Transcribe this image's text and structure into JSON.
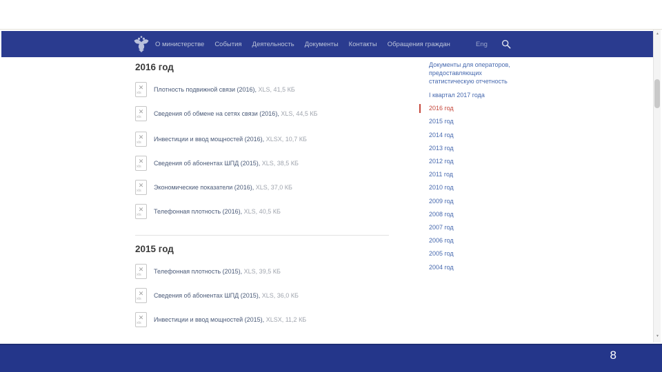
{
  "navbar": {
    "logo_icon": "russian-coat-of-arms",
    "items": [
      "О министерстве",
      "События",
      "Деятельность",
      "Документы",
      "Контакты",
      "Обращения граждан"
    ],
    "lang_label": "Eng",
    "search_icon": "magnifier"
  },
  "content": {
    "file_icon_label": "xls",
    "sections": [
      {
        "heading": "2016 год",
        "items": [
          {
            "title": "Плотность подвижной связи (2016),",
            "meta": "XLS, 41,5 КБ"
          },
          {
            "title": "Сведения об обмене на сетях связи (2016),",
            "meta": "XLS, 44,5 КБ"
          },
          {
            "title": "Инвестиции и ввод мощностей (2016),",
            "meta": "XLSX, 10,7 КБ"
          },
          {
            "title": "Сведения об абонентах ШПД (2015),",
            "meta": "XLS, 38,5 КБ"
          },
          {
            "title": "Экономические показатели (2016),",
            "meta": "XLS, 37,0 КБ"
          },
          {
            "title": "Телефонная плотность (2016),",
            "meta": "XLS, 40,5 КБ"
          }
        ]
      },
      {
        "heading": "2015 год",
        "items": [
          {
            "title": "Телефонная плотность (2015),",
            "meta": "XLS, 39,5 КБ"
          },
          {
            "title": "Сведения об абонентах ШПД (2015),",
            "meta": "XLS, 36,0 КБ"
          },
          {
            "title": "Инвестиции и ввод мощностей (2015),",
            "meta": "XLSX, 11,2 КБ"
          }
        ]
      }
    ]
  },
  "sidebar": {
    "title": "Документы для операторов, предоставляющих статистическую отчетность",
    "links": [
      {
        "label": "I квартал 2017 года",
        "active": false
      },
      {
        "label": "2016 год",
        "active": true
      },
      {
        "label": "2015 год",
        "active": false
      },
      {
        "label": "2014 год",
        "active": false
      },
      {
        "label": "2013 год",
        "active": false
      },
      {
        "label": "2012 год",
        "active": false
      },
      {
        "label": "2011 год",
        "active": false
      },
      {
        "label": "2010 год",
        "active": false
      },
      {
        "label": "2009 год",
        "active": false
      },
      {
        "label": "2008 год",
        "active": false
      },
      {
        "label": "2007 год",
        "active": false
      },
      {
        "label": "2006 год",
        "active": false
      },
      {
        "label": "2005 год",
        "active": false
      },
      {
        "label": "2004 год",
        "active": false
      }
    ]
  },
  "footer": {
    "page_number": "8"
  },
  "colors": {
    "navbar_blue": "#2a3b8f",
    "footer_blue": "#24368a",
    "link_blue": "#4668ae",
    "active_red": "#c5463a",
    "doc_title": "#4a5a78",
    "doc_meta": "#9fa4ad"
  }
}
